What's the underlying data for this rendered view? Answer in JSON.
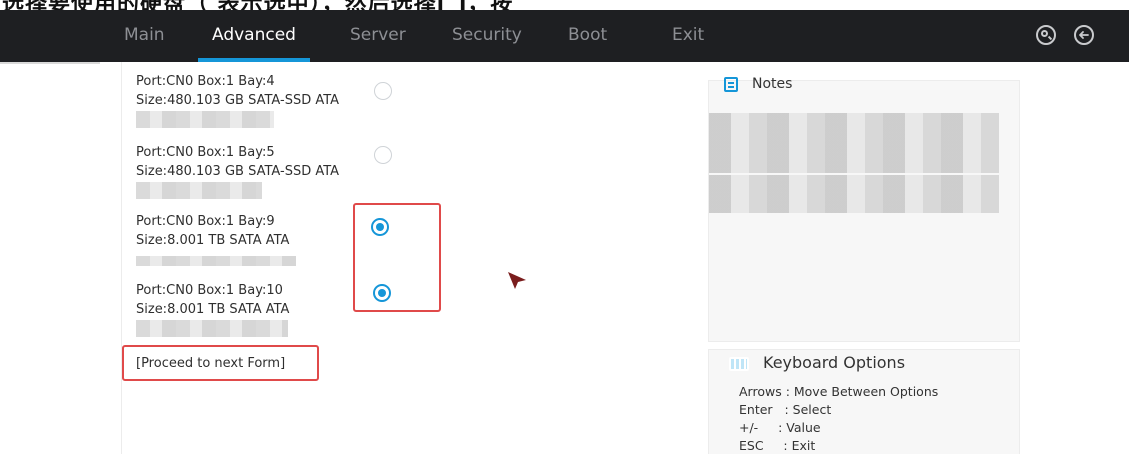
{
  "caption": {
    "text": "选择要使用的硬盘（ 表示选中），然后选择[ ]，按"
  },
  "nav": {
    "tabs": [
      {
        "label": "Main",
        "active": false
      },
      {
        "label": "Advanced",
        "active": true
      },
      {
        "label": "Server",
        "active": false
      },
      {
        "label": "Security",
        "active": false
      },
      {
        "label": "Boot",
        "active": false
      },
      {
        "label": "Exit",
        "active": false
      }
    ],
    "icons": [
      "search-icon",
      "back-icon"
    ]
  },
  "disks": [
    {
      "port_line": "Port:CN0 Box:1 Bay:4",
      "size_line": "Size:480.103 GB SATA-SSD ATA",
      "selected": false
    },
    {
      "port_line": "Port:CN0 Box:1 Bay:5",
      "size_line": "Size:480.103 GB SATA-SSD ATA",
      "selected": false
    },
    {
      "port_line": "Port:CN0 Box:1 Bay:9",
      "size_line": "Size:8.001 TB SATA ATA",
      "selected": true
    },
    {
      "port_line": "Port:CN0 Box:1 Bay:10",
      "size_line": "Size:8.001 TB SATA ATA",
      "selected": true
    }
  ],
  "proceed": {
    "label": "[Proceed to next Form]"
  },
  "notes": {
    "title": "Notes"
  },
  "keyboard": {
    "title": "Keyboard Options",
    "rows": [
      "Arrows : Move Between Options",
      "Enter   : Select",
      "+/-     : Value",
      "ESC     : Exit"
    ]
  },
  "colors": {
    "accent": "#1596d8",
    "highlight_box": "#e04a4a",
    "topbar": "#1e1f22"
  }
}
